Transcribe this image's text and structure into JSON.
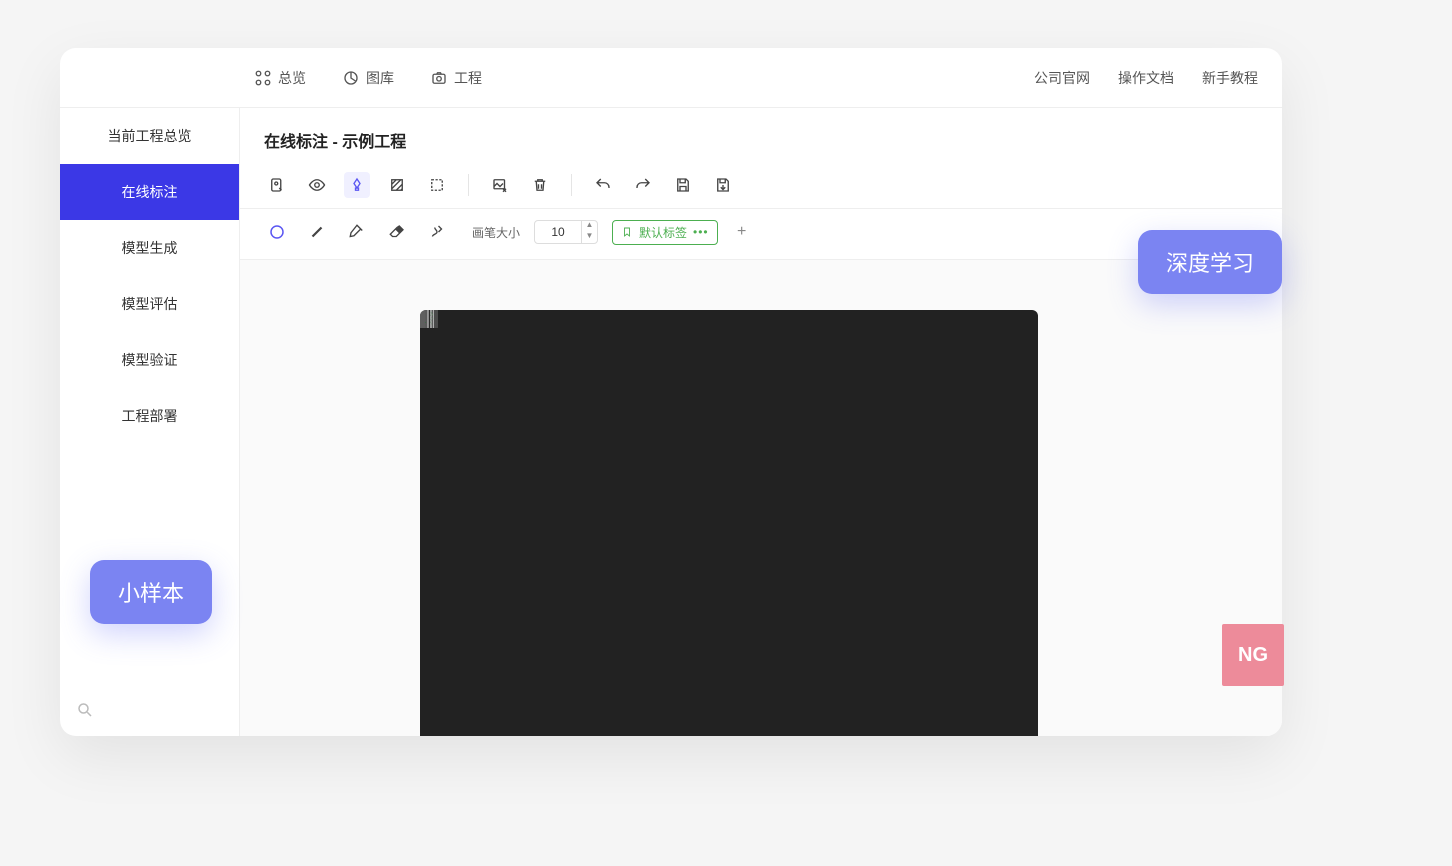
{
  "topnav": {
    "items": [
      {
        "label": "总览"
      },
      {
        "label": "图库"
      },
      {
        "label": "工程"
      }
    ],
    "links": [
      {
        "label": "公司官网"
      },
      {
        "label": "操作文档"
      },
      {
        "label": "新手教程"
      }
    ]
  },
  "sidebar": {
    "items": [
      {
        "label": "当前工程总览"
      },
      {
        "label": "在线标注"
      },
      {
        "label": "模型生成"
      },
      {
        "label": "模型评估"
      },
      {
        "label": "模型验证"
      },
      {
        "label": "工程部署"
      }
    ],
    "active_index": 1
  },
  "page": {
    "title": "在线标注 - 示例工程"
  },
  "brush": {
    "label": "画笔大小",
    "value": "10"
  },
  "tag": {
    "label": "默认标签"
  },
  "floats": {
    "left_label": "小样本",
    "right_label": "深度学习",
    "ng_label": "NG"
  }
}
